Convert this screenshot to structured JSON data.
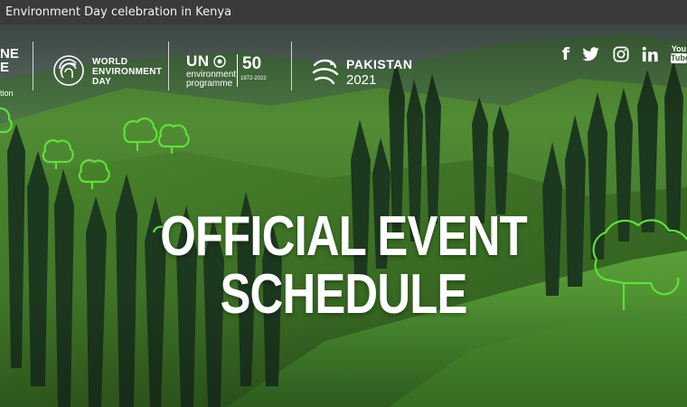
{
  "window": {
    "title": "Environment Day celebration in Kenya"
  },
  "header": {
    "partial_logo": {
      "line1": "NE",
      "line2": "E",
      "line3": "tion"
    },
    "wed_logo": {
      "line1": "WORLD",
      "line2": "ENVIRONMENT",
      "line3": "DAY"
    },
    "unep_logo": {
      "un": "UN",
      "line1": "environment",
      "line2": "programme",
      "fifty": "50",
      "years": "1972-2022"
    },
    "host_logo": {
      "name": "PAKISTAN",
      "year": "2021"
    }
  },
  "social": {
    "facebook": "f",
    "youtube_line1": "You",
    "youtube_line2": "Tube"
  },
  "hero": {
    "headline_line1": "OFFICIAL EVENT",
    "headline_line2": "SCHEDULE"
  },
  "colors": {
    "title_bar": "#3a3a3a",
    "accent_green": "#5fe03a",
    "text": "#ffffff"
  }
}
